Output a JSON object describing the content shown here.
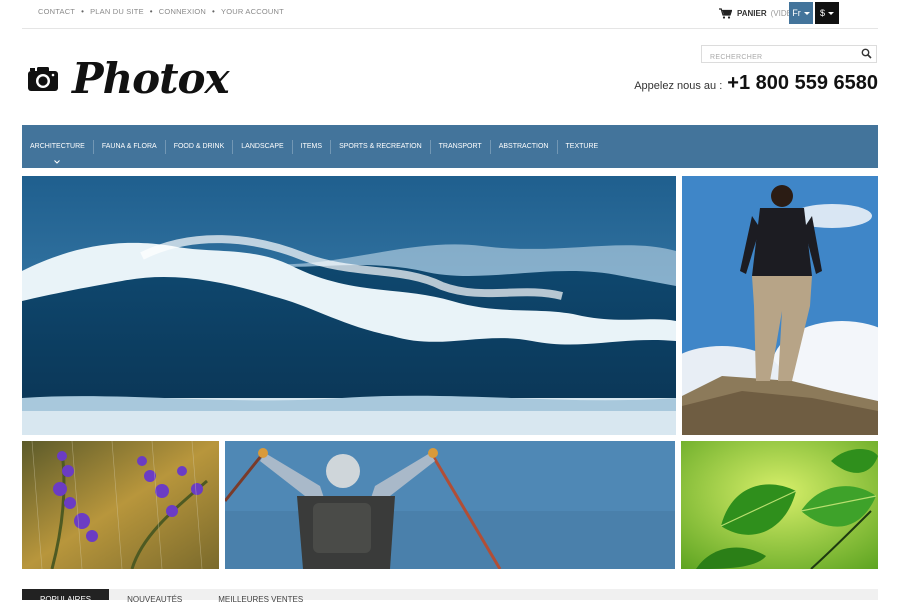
{
  "header": {
    "top_links": [
      "CONTACT",
      "PLAN DU SITE",
      "CONNEXION",
      "YOUR ACCOUNT"
    ],
    "cart": {
      "label": "PANIER",
      "status": "(VIDE)",
      "icon": "cart-icon"
    },
    "language": "Fr",
    "currency": "$",
    "search": {
      "placeholder": "RECHERCHER",
      "icon": "search-icon"
    },
    "logo": {
      "text": "Photox",
      "icon": "camera-icon"
    },
    "phone": {
      "label": "Appelez nous au :",
      "number": "+1 800 559 6580"
    }
  },
  "nav": {
    "items": [
      "ARCHITECTURE",
      "FAUNA & FLORA",
      "FOOD & DRINK",
      "LANDSCAPE",
      "ITEMS",
      "SPORTS & RECREATION",
      "TRANSPORT",
      "ABSTRACTION",
      "TEXTURE"
    ]
  },
  "banners": [
    {
      "name": "ocean-wave",
      "icon": "wave-photo"
    },
    {
      "name": "hiker-on-rock",
      "icon": "man-on-rock-photo"
    },
    {
      "name": "purple-flowers",
      "icon": "flowers-photo"
    },
    {
      "name": "hiker-with-poles",
      "icon": "hiker-photo"
    },
    {
      "name": "green-leaves",
      "icon": "leaves-photo"
    }
  ],
  "tabs": [
    "POPULAIRES",
    "NOUVEAUTÉS",
    "MEILLEURES VENTES"
  ],
  "colors": {
    "nav_bg": "#43749b",
    "accent_dark": "#111111"
  }
}
